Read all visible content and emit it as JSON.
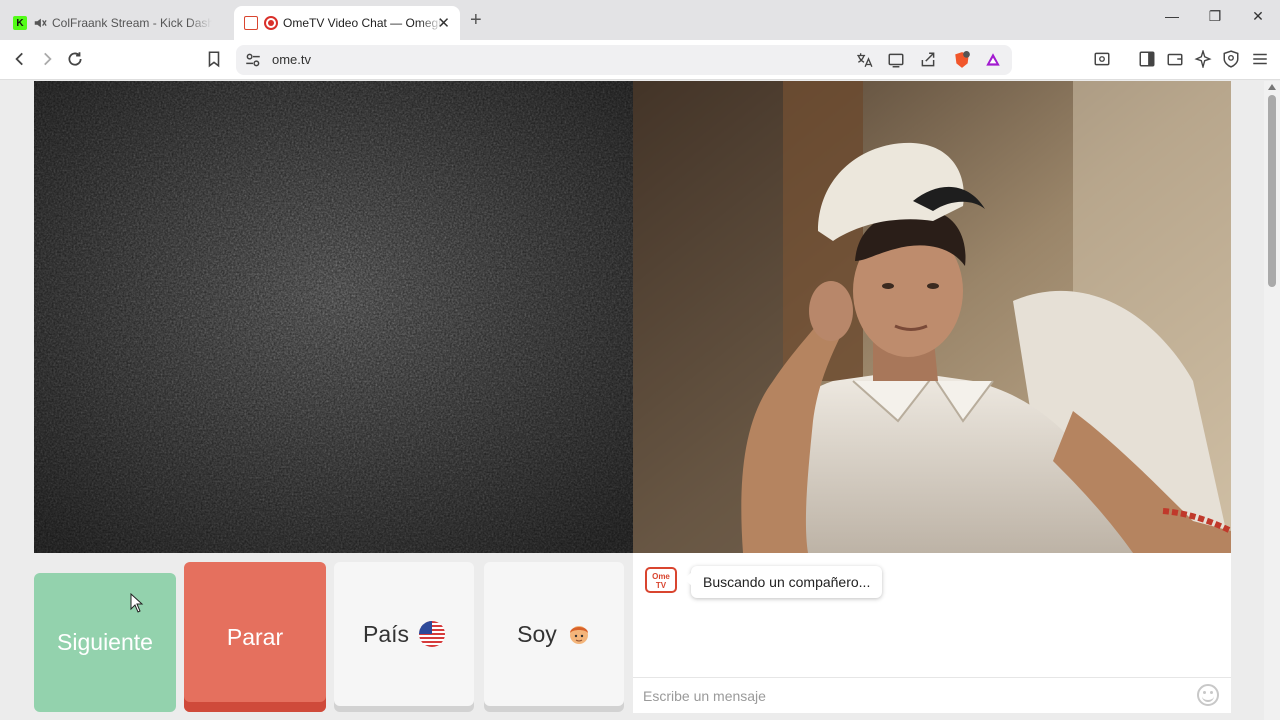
{
  "browser": {
    "tabs": [
      {
        "title": "ColFraank Stream - Kick Dashboard",
        "favicon": "kick-favicon",
        "muted": true,
        "active": false
      },
      {
        "title": "OmeTV Video Chat — Omegle",
        "favicon": "ometv-favicon",
        "recording": true,
        "active": true
      }
    ],
    "address": "ome.tv"
  },
  "controls": {
    "next_label": "Siguiente",
    "stop_label": "Parar",
    "country_label": "País",
    "gender_label": "Soy"
  },
  "chat": {
    "logo_text": "Ome TV",
    "status_message": "Buscando un compañero...",
    "input_placeholder": "Escribe un mensaje"
  },
  "colors": {
    "next_button": "#93d2ad",
    "stop_button": "#e5705e",
    "brand_red": "#d9452f"
  }
}
